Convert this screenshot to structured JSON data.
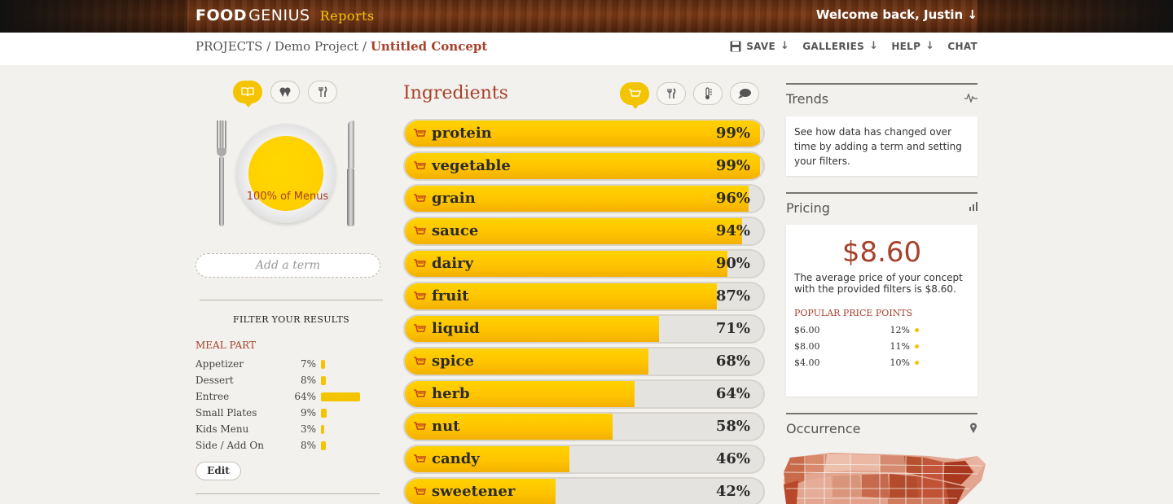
{
  "header": {
    "logo_food": "FOOD",
    "logo_genius": "GENIUS",
    "reports_label": "Reports",
    "welcome": "Welcome back, Justin ↓"
  },
  "breadcrumb": {
    "projects": "PROJECTS",
    "sep": "/",
    "project": "Demo Project",
    "current": "Untitled Concept"
  },
  "nav": {
    "save": "SAVE",
    "galleries": "GALLERIES",
    "help": "HELP",
    "chat": "CHAT"
  },
  "left": {
    "plate_label": "100% of Menus",
    "add_term_placeholder": "Add a term",
    "filter_title": "FILTER YOUR RESULTS",
    "section_title": "MEAL PART",
    "meal_parts": [
      {
        "label": "Appetizer",
        "pct": "7%",
        "value": 7
      },
      {
        "label": "Dessert",
        "pct": "8%",
        "value": 8
      },
      {
        "label": "Entree",
        "pct": "64%",
        "value": 64
      },
      {
        "label": "Small Plates",
        "pct": "9%",
        "value": 9
      },
      {
        "label": "Kids Menu",
        "pct": "3%",
        "value": 3
      },
      {
        "label": "Side / Add On",
        "pct": "8%",
        "value": 8
      }
    ],
    "edit_label": "Edit"
  },
  "ingredients": {
    "title": "Ingredients",
    "items": [
      {
        "name": "protein",
        "pct": "99%",
        "value": 99
      },
      {
        "name": "vegetable",
        "pct": "99%",
        "value": 99
      },
      {
        "name": "grain",
        "pct": "96%",
        "value": 96
      },
      {
        "name": "sauce",
        "pct": "94%",
        "value": 94
      },
      {
        "name": "dairy",
        "pct": "90%",
        "value": 90
      },
      {
        "name": "fruit",
        "pct": "87%",
        "value": 87
      },
      {
        "name": "liquid",
        "pct": "71%",
        "value": 71
      },
      {
        "name": "spice",
        "pct": "68%",
        "value": 68
      },
      {
        "name": "herb",
        "pct": "64%",
        "value": 64
      },
      {
        "name": "nut",
        "pct": "58%",
        "value": 58
      },
      {
        "name": "candy",
        "pct": "46%",
        "value": 46
      },
      {
        "name": "sweetener",
        "pct": "42%",
        "value": 42
      }
    ]
  },
  "right": {
    "trends_title": "Trends",
    "trends_text": "See how data has changed over time by adding a term and setting your filters.",
    "pricing_title": "Pricing",
    "price": "$8.60",
    "price_desc": "The average price of your concept with the provided filters is $8.60.",
    "popular_title": "POPULAR PRICE POINTS",
    "price_points": [
      {
        "price": "$6.00",
        "pct": "12%"
      },
      {
        "price": "$8.00",
        "pct": "11%"
      },
      {
        "price": "$4.00",
        "pct": "10%"
      }
    ],
    "occurrence_title": "Occurrence"
  },
  "colors": {
    "accent": "#a6412b",
    "yellow": "#f5c400"
  }
}
